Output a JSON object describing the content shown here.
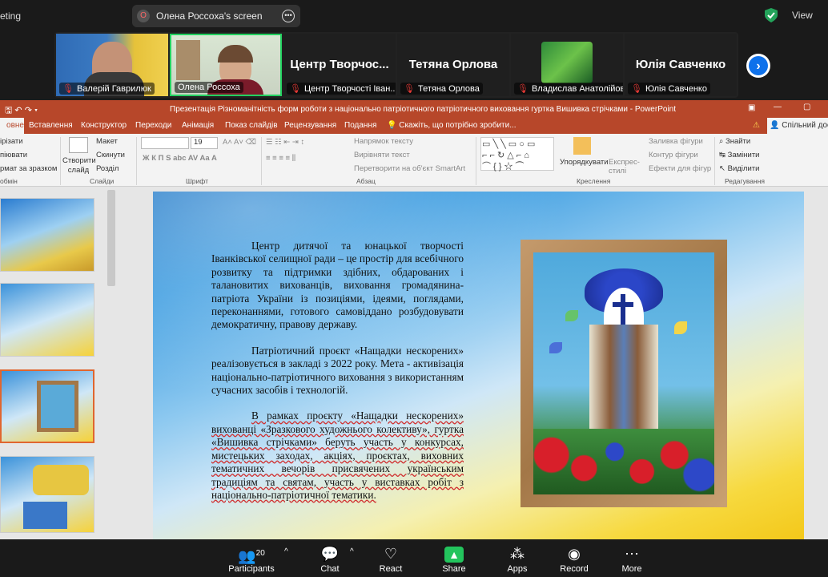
{
  "top": {
    "meeting_label": "eting",
    "screen_badge": "O",
    "screen_label": "Олена Россоха's screen",
    "view_label": "View"
  },
  "gallery": [
    {
      "name": "Валерій Гаврилюк",
      "big": ""
    },
    {
      "name": "Олена Россоха",
      "big": ""
    },
    {
      "name": "Центр Творчості Іван...",
      "big": "Центр Творчос..."
    },
    {
      "name": "Тетяна Орлова",
      "big": "Тетяна Орлова"
    },
    {
      "name": "Владислав Анатолійов...",
      "big": ""
    },
    {
      "name": "Юлія Савченко",
      "big": "Юлія Савченко"
    }
  ],
  "ppt": {
    "title": "Презентація Різноманітність форм роботи з національно патріотичного патріотичного виховання гуртка Вишивка стрічками - PowerPoint",
    "tabs": [
      "овне",
      "Вставлення",
      "Конструктор",
      "Переходи",
      "Анімація",
      "Показ слайдів",
      "Рецензування",
      "Подання",
      "Скажіть, що потрібно зробити...",
      "Спільний дост"
    ],
    "ribbon": {
      "cut": "ірізати",
      "copy": "піювати",
      "format": "рмат за зразком",
      "clipboard": "обмін",
      "new_slide": "Створити слайд",
      "layout": "Макет",
      "reset": "Скинути",
      "section": "Розділ",
      "slides": "Слайди",
      "font_name": "",
      "font_size": "19",
      "font": "Шрифт",
      "text_direction": "Напрямок тексту",
      "align_text": "Вирівняти текст",
      "smartart": "Перетворити на об'єкт SmartArt",
      "paragraph": "Абзац",
      "arrange": "Упорядкувати",
      "quick_styles": "Експрес-стилі",
      "drawing": "Креслення",
      "shape_fill": "Заливка фігури",
      "shape_outline": "Контур фігури",
      "shape_effects": "Ефекти для фігур",
      "find": "Знайти",
      "replace": "Замінити",
      "select": "Виділити",
      "editing": "Редагування"
    },
    "slide": {
      "p1": "Центр дитячої та юнацької творчості Іванківської селищної ради – це простір для всебічного розвитку та підтримки здібних, обдарованих і талановитих вихованців, виховання громадянина-патріота України із позиціями, ідеями, поглядами, переконаннями, готового самовіддано розбудовувати демократичну, правову державу.",
      "p2": "Патріотичний проєкт «Нащадки нескорених» реалізовується в закладі з 2022 року. Мета - активізація національно-патріотичного виховання з використанням сучасних засобів і технологій.",
      "p3": "В рамках проєкту «Нащадки нескорених» вихованці «Зразкового художнього колективу», гуртка «Вишивка стрічками» беруть участь у конкурсах, мистецьких заходах, акціях, проєктах, виховних тематичних вечорів присвячених українським традиціям та святам, участь у виставках робіт з національно-патріотичної тематики."
    }
  },
  "bottom": {
    "participants": "Participants",
    "participants_count": "20",
    "chat": "Chat",
    "react": "React",
    "share": "Share",
    "apps": "Apps",
    "record": "Record",
    "more": "More"
  }
}
